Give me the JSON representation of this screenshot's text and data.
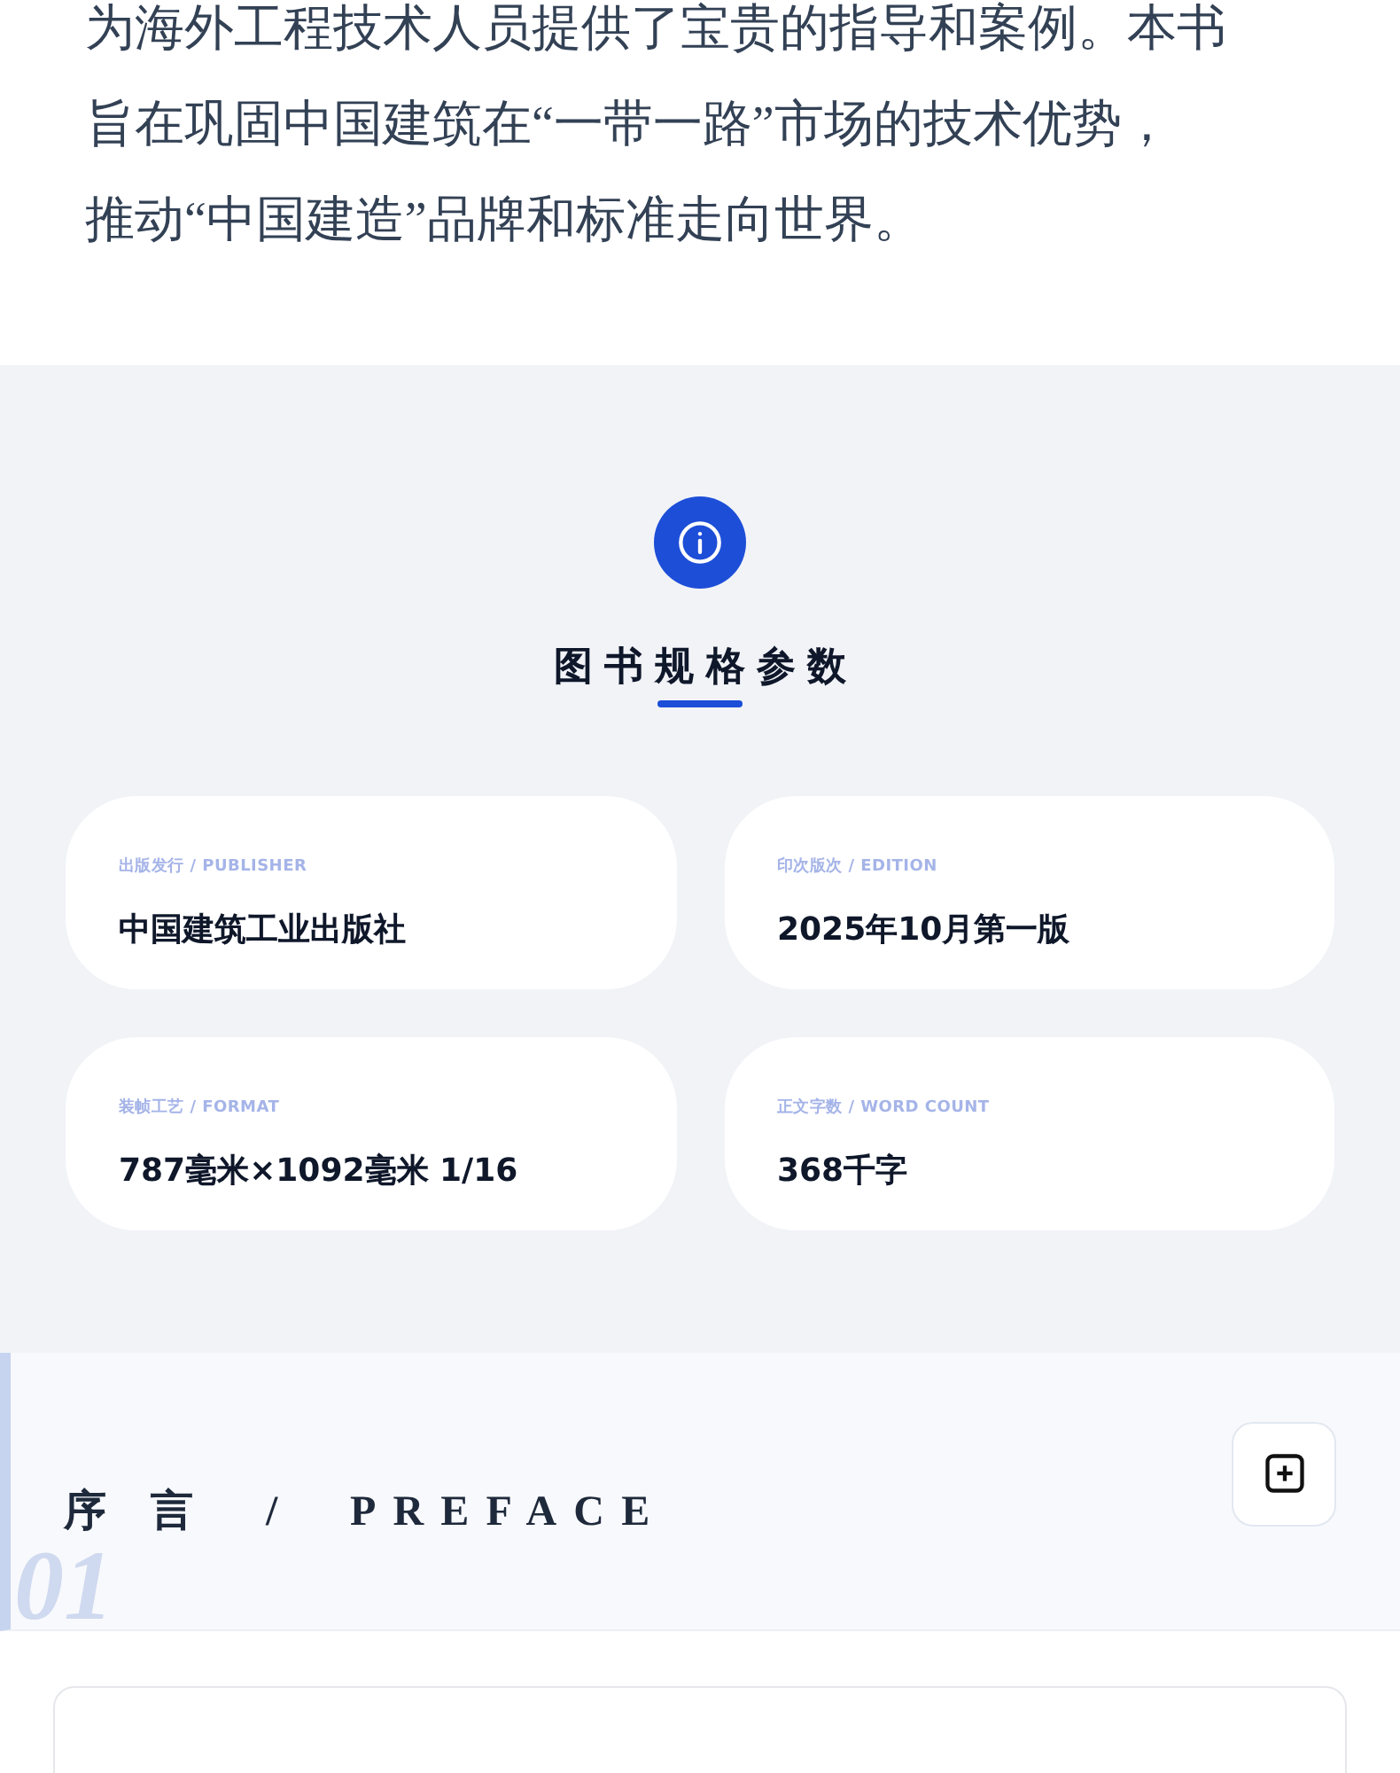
{
  "intro": {
    "lines": [
      "为海外工程技术人员提供了宝贵的指导和案例。本书",
      "旨在巩固中国建筑在“一带一路”市场的技术优势，",
      "推动“中国建造”品牌和标准走向世界。"
    ]
  },
  "specs": {
    "title": "图书规格参数",
    "items": [
      {
        "label": "出版发行 / PUBLISHER",
        "value": "中国建筑工业出版社"
      },
      {
        "label": "印次版次 / EDITION",
        "value": "2025年10月第一版"
      },
      {
        "label": "装帧工艺 / FORMAT",
        "value": "787毫米×1092毫米 1/16"
      },
      {
        "label": "正文字数 / WORD COUNT",
        "value": "368千字"
      }
    ]
  },
  "preface": {
    "number": "01",
    "title": "序 言  /  PREFACE",
    "expanded": false
  }
}
